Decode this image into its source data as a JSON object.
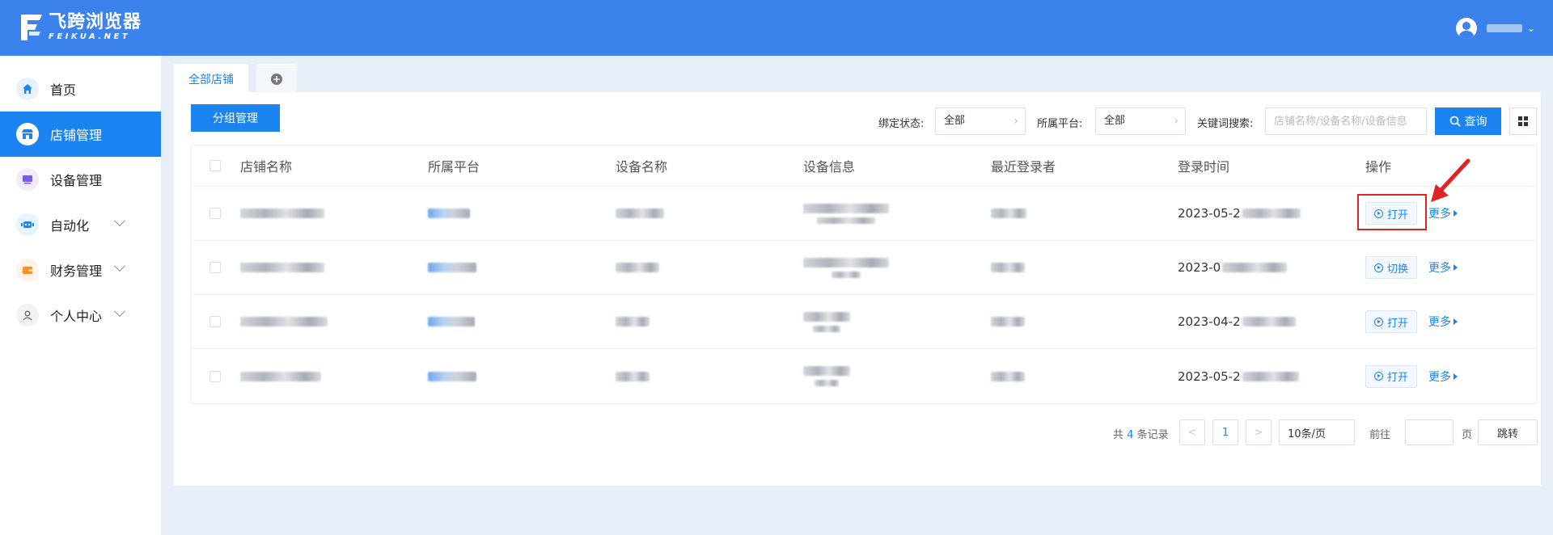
{
  "app": {
    "logo_cn": "飞跨浏览器",
    "logo_en": "FEIKUA.NET",
    "brand_color": "#3b82ec"
  },
  "sidebar": {
    "items": [
      {
        "label": "首页",
        "icon": "home-icon"
      },
      {
        "label": "店铺管理",
        "icon": "store-icon"
      },
      {
        "label": "设备管理",
        "icon": "device-icon"
      },
      {
        "label": "自动化",
        "icon": "automation-icon"
      },
      {
        "label": "财务管理",
        "icon": "wallet-icon"
      },
      {
        "label": "个人中心",
        "icon": "user-icon"
      }
    ]
  },
  "tabs": {
    "active_label": "全部店铺",
    "add_icon": "plus-circle-icon"
  },
  "toolbar": {
    "group_btn": "分组管理",
    "bind_label": "绑定状态:",
    "bind_value": "全部",
    "platform_label": "所属平台:",
    "platform_value": "全部",
    "keyword_label": "关键词搜索:",
    "keyword_placeholder": "店铺名称/设备名称/设备信息",
    "search_btn": "查询"
  },
  "table": {
    "headers": [
      "店铺名称",
      "所属平台",
      "设备名称",
      "设备信息",
      "最近登录者",
      "登录时间",
      "操作"
    ],
    "rows": [
      {
        "time": "2023-05-2",
        "op": "打开",
        "more": "更多"
      },
      {
        "time": "2023-0",
        "op": "切换",
        "more": "更多"
      },
      {
        "time": "2023-04-2",
        "op": "打开",
        "more": "更多"
      },
      {
        "time": "2023-05-2",
        "op": "打开",
        "more": "更多"
      }
    ]
  },
  "pagination": {
    "total_prefix": "共",
    "total": "4",
    "total_suffix": "条记录",
    "prev": "<",
    "page": "1",
    "next": ">",
    "page_size": "10条/页",
    "goto_label": "前往",
    "page_unit": "页",
    "jump_btn": "跳转"
  }
}
